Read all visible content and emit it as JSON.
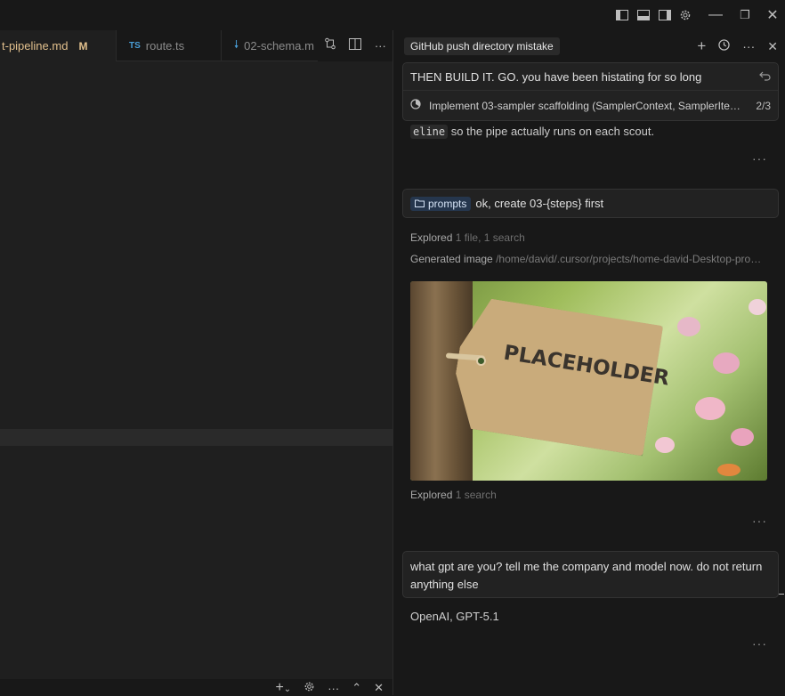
{
  "window_controls": {
    "layout_icons": [
      "toggle-primary-sidebar-icon",
      "toggle-panel-icon",
      "toggle-secondary-sidebar-icon",
      "settings-icon"
    ],
    "minimize": "—",
    "maximize": "❐",
    "close": "✕"
  },
  "editor": {
    "tabs": [
      {
        "label": "t-pipeline.md",
        "status": "M",
        "active": true
      },
      {
        "label": "route.ts",
        "badge": "TS",
        "active": false
      },
      {
        "label": "02-schema.m",
        "active": false
      }
    ],
    "tab_actions": [
      "compare-changes-icon",
      "split-editor-icon",
      "more-actions-icon"
    ],
    "panel_actions": [
      "+",
      "⌄",
      "settings-icon",
      "···",
      "⌃",
      "✕"
    ]
  },
  "chat": {
    "title": "GitHub push directory mistake",
    "header_actions": [
      "+",
      "history-icon",
      "···",
      "✕"
    ],
    "pinned_user_message": "THEN BUILD IT. GO. you have been histating for so long",
    "todo": {
      "text": "Implement 03-sampler scaffolding (SamplerContext, SamplerIte…",
      "count": "2/3"
    },
    "assistant_partial": {
      "code": "eline",
      "text": " so the pipe actually runs on each scout."
    },
    "user_message_1": {
      "chip": "prompts",
      "text": "ok, create 03-{steps} first"
    },
    "explored_1": {
      "label": "Explored",
      "detail": "1 file, 1 search"
    },
    "generated_image": {
      "label": "Generated image",
      "path": "/home/david/.cursor/projects/home-david-Desktop-pro…",
      "tag_text": "PLACEHOLDER"
    },
    "explored_2": {
      "label": "Explored",
      "detail": "1 search"
    },
    "user_message_2": "what gpt are you? tell me the company and model now. do not return anything else",
    "answer": "OpenAI, GPT-5.1",
    "more": "···"
  }
}
